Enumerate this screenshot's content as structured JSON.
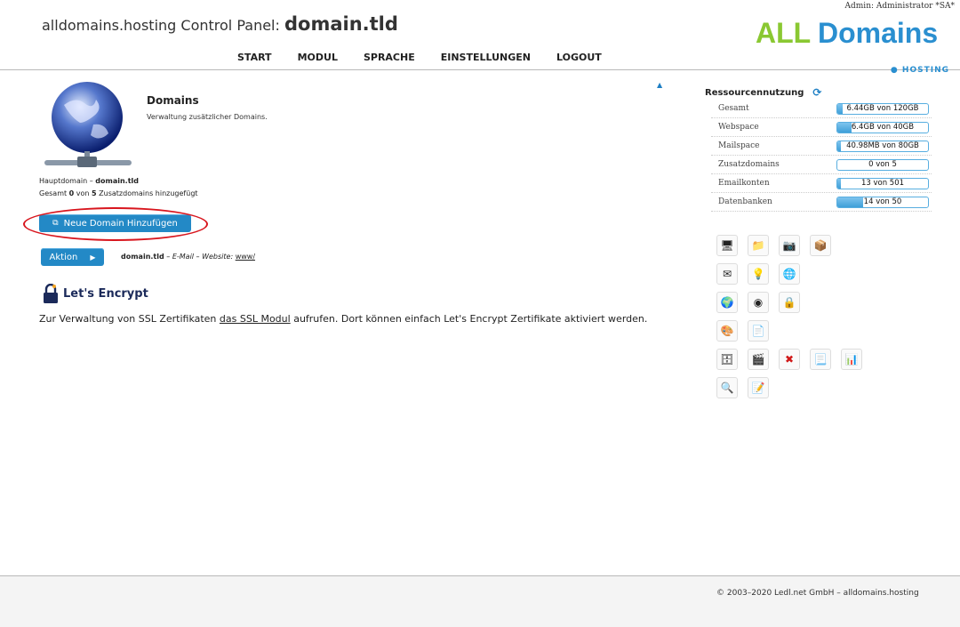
{
  "header": {
    "admin_line": "Admin: Administrator *SA*",
    "title_prefix": "alldomains.hosting Control Panel:",
    "title_domain": "domain.tld",
    "logo_main": "ALLDomains",
    "logo_sub": "HOSTING",
    "nav": [
      "START",
      "MODUL",
      "SPRACHE",
      "EINSTELLUNGEN",
      "LOGOUT"
    ]
  },
  "module": {
    "icon": "globe-network-icon",
    "title": "Domains",
    "description": "Verwaltung zusätzlicher Domains.",
    "hauptdomain_label": "Hauptdomain –",
    "hauptdomain_value": "domain.tld",
    "gesamt_prefix": "Gesamt",
    "gesamt_used": "0",
    "gesamt_mid": "von",
    "gesamt_total": "5",
    "gesamt_suffix": "Zusatzdomains hinzugefügt",
    "new_domain_button": "Neue Domain Hinzufügen",
    "action_button": "Aktion",
    "domain_entry": {
      "domain": "domain.tld",
      "email_text": "– E-Mail – Website:",
      "website_link": "www/"
    }
  },
  "letsencrypt": {
    "logo_text": "Let's Encrypt",
    "text_before": "Zur Verwaltung von SSL Zertifikaten",
    "link_text": "das SSL Modul",
    "text_after": "aufrufen. Dort können einfach Let's Encrypt Zertifikate aktiviert werden."
  },
  "resources": {
    "title": "Ressourcennutzung",
    "rows": [
      {
        "label": "Gesamt",
        "value": "6.44GB von 120GB",
        "fraction": 0.054
      },
      {
        "label": "Webspace",
        "value": "6.4GB von 40GB",
        "fraction": 0.16
      },
      {
        "label": "Mailspace",
        "value": "40.98MB von 80GB",
        "fraction": 0.005
      },
      {
        "label": "Zusatzdomains",
        "value": "0 von 5",
        "fraction": 0
      },
      {
        "label": "Emailkonten",
        "value": "13 von 501",
        "fraction": 0.026
      },
      {
        "label": "Datenbanken",
        "value": "14 von 50",
        "fraction": 0.28
      }
    ]
  },
  "module_icons": [
    [
      "monitor-icon",
      "folder-icon",
      "camera-icon",
      "box-icon"
    ],
    [
      "mail-icon",
      "bulb-icon",
      "globe-mail-icon"
    ],
    [
      "network-globe-icon",
      "circle-icon",
      "lock-icon"
    ],
    [
      "palette-icon",
      "document-stack-icon"
    ],
    [
      "database-icon",
      "film-icon",
      "delete-icon",
      "page-icon",
      "chart-icon"
    ],
    [
      "search-tools-icon",
      "notes-icon"
    ]
  ],
  "footer": {
    "copyright": "© 2003–2020 Ledl.net GmbH – alldomains.hosting"
  }
}
